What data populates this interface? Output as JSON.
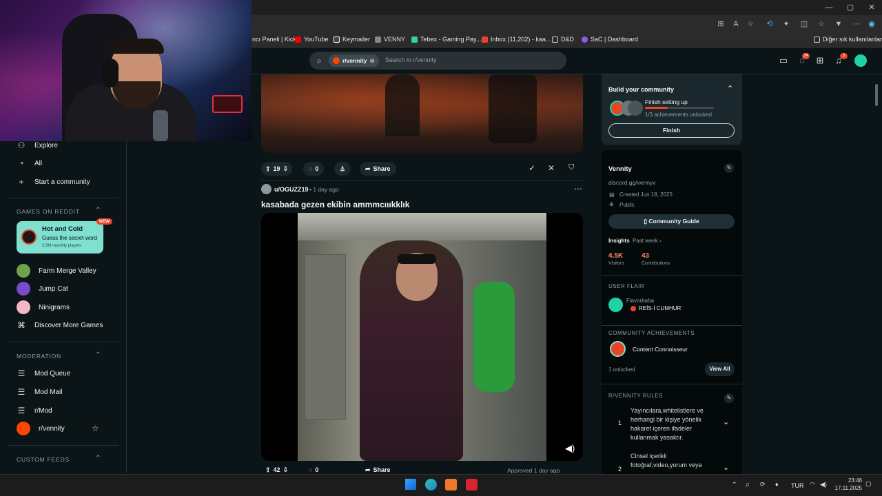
{
  "browser": {
    "bookmarks": [
      {
        "label": "ncı Paneli | Kick",
        "color": "#53fc18"
      },
      {
        "label": "YouTube",
        "color": "#ff0000"
      },
      {
        "label": "Keymailer",
        "color": "#ffffff"
      },
      {
        "label": "VENNY",
        "color": "#ffffff"
      },
      {
        "label": "Tebex - Gaming Pay...",
        "color": "#34d399"
      },
      {
        "label": "Inbox (11,202) - kaa...",
        "color": "#ea4335"
      },
      {
        "label": "D&D",
        "color": "#f0c000"
      },
      {
        "label": "SaC | Dashboard",
        "color": "#8b5cf6"
      }
    ],
    "other_bookmarks": "Diğer sık kullanılanlar"
  },
  "header": {
    "search_chip": "r/vennity",
    "search_placeholder": "Search in r/vennity",
    "chat_badge": "34",
    "notif_badge": "3"
  },
  "left_nav": {
    "top_items": [
      {
        "label": "Explore",
        "icon": "compass-icon"
      },
      {
        "label": "All",
        "icon": "chart-icon"
      },
      {
        "label": "Start a community",
        "icon": "plus-icon"
      }
    ],
    "games_heading": "GAMES ON REDDIT",
    "featured_game": {
      "title": "Hot and Cold",
      "subtitle": "Guess the secret word",
      "players": "3.9M monthly players",
      "badge": "NEW"
    },
    "games": [
      "Farm Merge Valley",
      "Jump Cat",
      "Ninigrams",
      "Discover More Games"
    ],
    "moderation_heading": "MODERATION",
    "moderation": [
      "Mod Queue",
      "Mod Mail",
      "r/Mod",
      "r/vennity"
    ],
    "custom_feeds_heading": "CUSTOM FEEDS"
  },
  "feed": {
    "prev_post": {
      "votes": "19",
      "comments": "0",
      "share": "Share"
    },
    "post": {
      "author": "u/OGUZZ19",
      "time": "• 1 day ago",
      "title": "kasabada gezen ekibin ammmcıııkklık",
      "votes": "42",
      "comments": "0",
      "share": "Share",
      "approved": "Approved 1 day ago"
    }
  },
  "right_sidebar": {
    "build": {
      "title": "Build your community",
      "step": "Finish setting up",
      "progress_text": "1/3 achievements unlocked",
      "progress": 0.33,
      "button": "Finish"
    },
    "community": {
      "name": "Vennity",
      "description": "discord.gg/vennyv",
      "created": "Created Jun 18, 2025",
      "visibility": "Public",
      "guide_button": "Community Guide",
      "insights_label": "Insights",
      "insights_period": "Past week",
      "visitors_value": "4.5K",
      "visitors_label": "Visitors",
      "contrib_value": "43",
      "contrib_label": "Contributions"
    },
    "flair": {
      "heading": "USER FLAIR",
      "username": "Flavorbaba",
      "flair": "REİS-İ CUMHUR"
    },
    "achievements": {
      "heading": "COMMUNITY ACHIEVEMENTS",
      "item": "Content Connoisseur",
      "unlocked": "1 unlocked",
      "button": "View All"
    },
    "rules": {
      "heading": "R/VENNITY RULES",
      "items": [
        {
          "num": "1",
          "text": "Yayıncılara,whitelistlere ve herhangi bir kişiye yönelik hakaret içeren ifadeler kullanmak yasaktır."
        },
        {
          "num": "2",
          "text": "Cinsel içerikli fotoğraf,video,yorum veya"
        }
      ]
    }
  },
  "taskbar": {
    "lang": "TUR",
    "time": "23:46",
    "date": "17.11.2025"
  },
  "colors": {
    "accent": "#ff4500",
    "orange_text": "#ff8b60",
    "teal": "#1fd1a6"
  }
}
